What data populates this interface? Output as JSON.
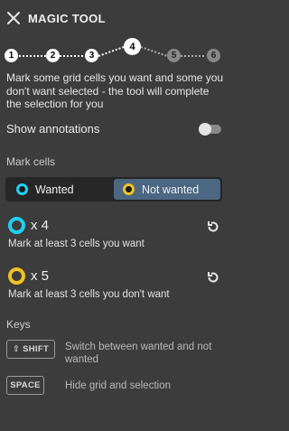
{
  "header": {
    "title": "MAGIC TOOL"
  },
  "stepper": {
    "steps": [
      "1",
      "2",
      "3",
      "4",
      "5",
      "6"
    ],
    "current_step": 4
  },
  "instructions": "Mark some grid cells you want and some you don't want selected - the tool will complete the selection for you",
  "annotations": {
    "label": "Show annotations",
    "enabled": false
  },
  "mark_cells": {
    "label": "Mark cells",
    "options": [
      "Wanted",
      "Not wanted"
    ],
    "selected": "Not wanted"
  },
  "counters": [
    {
      "color": "#1fd1f0",
      "count_text": "x 4",
      "hint": "Mark at least 3 cells you want"
    },
    {
      "color": "#f2c222",
      "count_text": "x 5",
      "hint": "Mark at least 3 cells you don't want"
    }
  ],
  "keys": {
    "label": "Keys",
    "items": [
      {
        "key": "⇧ SHIFT",
        "description": "Switch between wanted and not wanted"
      },
      {
        "key": "SPACE",
        "description": "Hide grid and selection"
      }
    ]
  },
  "colors": {
    "background": "#3c3c3c",
    "accent": "#4b6782",
    "wanted": "#1fd1f0",
    "not_wanted": "#f2c222"
  }
}
